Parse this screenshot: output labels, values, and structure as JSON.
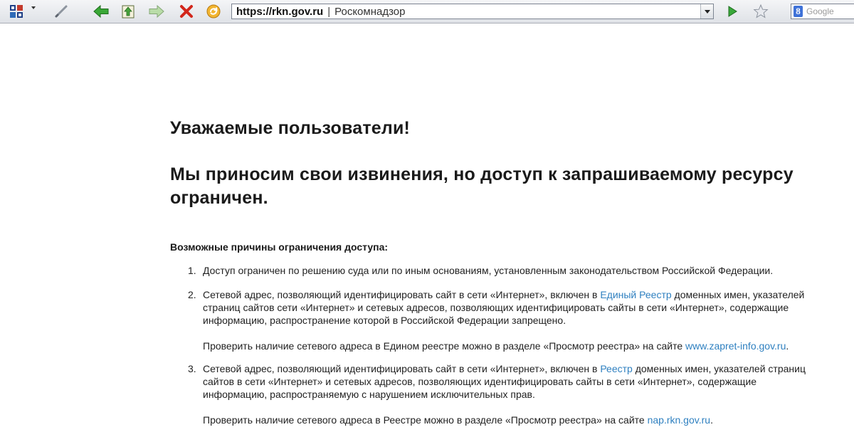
{
  "browser": {
    "address_url": "https://rkn.gov.ru",
    "address_separator": "|",
    "page_title": "Роскомнадзор",
    "search_placeholder": "Google",
    "search_engine_letter": "8"
  },
  "page": {
    "greeting": "Уважаемые пользователи!",
    "message": "Мы приносим свои извинения, но доступ к запрашиваемому ресурсу ограничен.",
    "reasons_title": "Возможные причины ограничения доступа:",
    "reasons": [
      {
        "number": "1.",
        "text": "Доступ ограничен  по решению суда или по иным основаниям, установленным законодательством Российской Федерации."
      },
      {
        "number": "2.",
        "text_before": "Сетевой адрес, позволяющий идентифицировать сайт в сети «Интернет», включен в ",
        "link": "Единый Реестр",
        "text_after": " доменных имен, указателей страниц сайтов сети «Интернет» и сетевых адресов, позволяющих идентифицировать сайты в сети «Интернет», содержащие информацию, распространение которой в Российской Федерации запрещено.",
        "check_before": "Проверить наличие сетевого адреса в Едином реестре можно в разделе «Просмотр реестра» на сайте ",
        "check_link": "www.zapret-info.gov.ru",
        "check_after": "."
      },
      {
        "number": "3.",
        "text_before": "Сетевой адрес, позволяющий идентифицировать сайт в сети «Интернет», включен в ",
        "link": "Реестр",
        "text_after": " доменных имен, указателей страниц сайтов в сети «Интернет» и сетевых адресов, позволяющих идентифицировать сайты в сети «Интернет», содержащие информацию, распространяемую с нарушением исключительных прав.",
        "check_before": "Проверить наличие сетевого адреса в Реестре можно в разделе «Просмотр реестра» на сайте ",
        "check_link": "nap.rkn.gov.ru",
        "check_after": "."
      }
    ]
  },
  "colors": {
    "link": "#2f80c0",
    "text": "#1a1a1a"
  },
  "icons": {
    "apps": "grid-apps-icon",
    "edit": "pencil-icon",
    "back": "back-arrow-icon",
    "home": "home-up-icon",
    "forward": "forward-arrow-icon",
    "stop": "stop-x-icon",
    "reload": "reload-icon",
    "go": "go-play-icon",
    "bookmark": "star-icon"
  }
}
